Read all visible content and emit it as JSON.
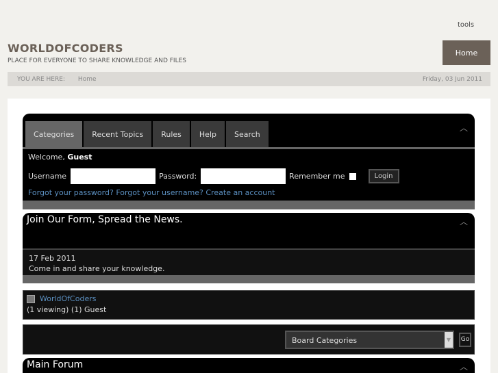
{
  "header": {
    "tools": "tools",
    "logo": "WORLDOFCODERS",
    "tagline": "PLACE FOR EVERYONE TO SHARE KNOWLEDGE AND FILES",
    "home": "Home"
  },
  "breadcrumb": {
    "label": "YOU ARE HERE:",
    "home": "Home",
    "date": "Friday, 03 Jun 2011"
  },
  "tabs": [
    "Categories",
    "Recent Topics",
    "Rules",
    "Help",
    "Search"
  ],
  "login": {
    "welcome": "Welcome,",
    "user": "Guest",
    "username": "Username",
    "password": "Password:",
    "remember": "Remember me",
    "button": "Login",
    "forgot_pw": "Forgot your password?",
    "forgot_user": "Forgot your username?",
    "create": "Create an account"
  },
  "news": {
    "title": "Join Our Form, Spread the News.",
    "date": "17 Feb 2011",
    "text": "Come in and share your knowledge."
  },
  "online": {
    "name": "WorldOfCoders",
    "status": "(1 viewing) (1) Guest"
  },
  "jump": {
    "select": "Board Categories",
    "go": "Go"
  },
  "forum": {
    "title": "Main Forum"
  }
}
